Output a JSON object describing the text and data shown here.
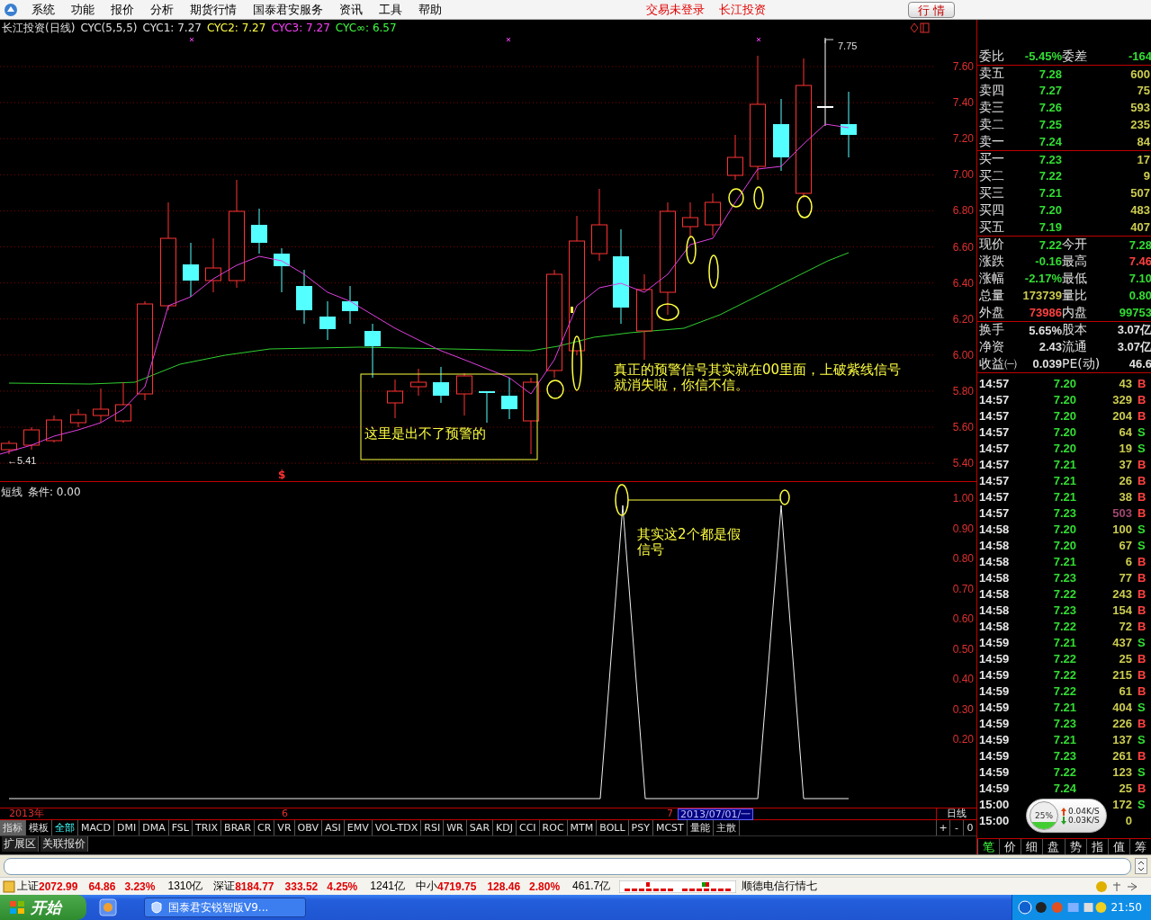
{
  "menu": {
    "items": [
      "系统",
      "功能",
      "报价",
      "分析",
      "期货行情",
      "国泰君安服务",
      "资讯",
      "工具",
      "帮助"
    ],
    "status": [
      "交易未登录",
      "长江投资"
    ],
    "button": "行 情"
  },
  "chart": {
    "legend": [
      {
        "text": "长江投资(日线)",
        "color": "#e0e0e0"
      },
      {
        "text": "CYC(5,5,5)",
        "color": "#e0e0e0"
      },
      {
        "text": "CYC1: 7.27",
        "color": "#e0e0e0"
      },
      {
        "text": "CYC2: 7.27",
        "color": "#ffff40"
      },
      {
        "text": "CYC3: 7.27",
        "color": "#ff40ff"
      },
      {
        "text": "CYC∞: 6.57",
        "color": "#40ff40"
      }
    ],
    "price_axis": [
      "7.60",
      "7.40",
      "7.20",
      "7.00",
      "6.80",
      "6.60",
      "6.40",
      "6.20",
      "6.00",
      "5.80",
      "5.60",
      "5.40"
    ],
    "low_label": "←5.41",
    "high_label": "7.75",
    "signal_mark": "$",
    "notes": [
      "这里是出不了预警的",
      "真正的预警信号其实就在00里面，上破紫线信号就消失啦，你信不信。"
    ]
  },
  "indicator": {
    "name": "短线",
    "condition": "条件: 0.00",
    "axis": [
      "1.00",
      "0.90",
      "0.80",
      "0.70",
      "0.60",
      "0.50",
      "0.40",
      "0.30",
      "0.20"
    ],
    "note": "其实这2个都是假信号"
  },
  "date_axis": {
    "labels": [
      "2013年",
      "6",
      "7"
    ],
    "cursor": "2013/07/01/一",
    "period": "日线"
  },
  "indicator_tabs": [
    {
      "label": "指标",
      "selected": true,
      "accent": false
    },
    {
      "label": "模板",
      "selected": false,
      "accent": false
    },
    {
      "label": "全部",
      "selected": false,
      "accent": true
    },
    {
      "label": "MACD",
      "selected": false,
      "accent": false
    },
    {
      "label": "DMI",
      "selected": false,
      "accent": false
    },
    {
      "label": "DMA",
      "selected": false,
      "accent": false
    },
    {
      "label": "FSL",
      "selected": false,
      "accent": false
    },
    {
      "label": "TRIX",
      "selected": false,
      "accent": false
    },
    {
      "label": "BRAR",
      "selected": false,
      "accent": false
    },
    {
      "label": "CR",
      "selected": false,
      "accent": false
    },
    {
      "label": "VR",
      "selected": false,
      "accent": false
    },
    {
      "label": "OBV",
      "selected": false,
      "accent": false
    },
    {
      "label": "ASI",
      "selected": false,
      "accent": false
    },
    {
      "label": "EMV",
      "selected": false,
      "accent": false
    },
    {
      "label": "VOL-TDX",
      "selected": false,
      "accent": false
    },
    {
      "label": "RSI",
      "selected": false,
      "accent": false
    },
    {
      "label": "WR",
      "selected": false,
      "accent": false
    },
    {
      "label": "SAR",
      "selected": false,
      "accent": false
    },
    {
      "label": "KDJ",
      "selected": false,
      "accent": false
    },
    {
      "label": "CCI",
      "selected": false,
      "accent": false
    },
    {
      "label": "ROC",
      "selected": false,
      "accent": false
    },
    {
      "label": "MTM",
      "selected": false,
      "accent": false
    },
    {
      "label": "BOLL",
      "selected": false,
      "accent": false
    },
    {
      "label": "PSY",
      "selected": false,
      "accent": false
    },
    {
      "label": "MCST",
      "selected": false,
      "accent": false
    },
    {
      "label": "量能",
      "selected": false,
      "accent": false
    },
    {
      "label": "主散",
      "selected": false,
      "accent": false
    }
  ],
  "zoom_buttons": [
    "+",
    "-",
    "0"
  ],
  "extra_tabs": [
    "扩展区",
    "关联报价"
  ],
  "quote": {
    "ratio": [
      {
        "label": "委比",
        "value": "-5.45%",
        "color": "#33dd33"
      },
      {
        "label": "委差",
        "value": "-164",
        "color": "#33dd33"
      }
    ],
    "asks": [
      {
        "label": "卖五",
        "price": "7.28",
        "volume": "600"
      },
      {
        "label": "卖四",
        "price": "7.27",
        "volume": "75"
      },
      {
        "label": "卖三",
        "price": "7.26",
        "volume": "593"
      },
      {
        "label": "卖二",
        "price": "7.25",
        "volume": "235"
      },
      {
        "label": "卖一",
        "price": "7.24",
        "volume": "84"
      }
    ],
    "bids": [
      {
        "label": "买一",
        "price": "7.23",
        "volume": "17"
      },
      {
        "label": "买二",
        "price": "7.22",
        "volume": "9"
      },
      {
        "label": "买三",
        "price": "7.21",
        "volume": "507"
      },
      {
        "label": "买四",
        "price": "7.20",
        "volume": "483"
      },
      {
        "label": "买五",
        "price": "7.19",
        "volume": "407"
      }
    ],
    "stats": [
      [
        {
          "label": "现价",
          "value": "7.22",
          "color": "#33dd33"
        },
        {
          "label": "今开",
          "value": "7.28",
          "color": "#33dd33"
        }
      ],
      [
        {
          "label": "涨跌",
          "value": "-0.16",
          "color": "#33dd33"
        },
        {
          "label": "最高",
          "value": "7.46",
          "color": "#ff4040"
        }
      ],
      [
        {
          "label": "涨幅",
          "value": "-2.17%",
          "color": "#33dd33"
        },
        {
          "label": "最低",
          "value": "7.10",
          "color": "#33dd33"
        }
      ],
      [
        {
          "label": "总量",
          "value": "173739",
          "color": "#cccc50"
        },
        {
          "label": "量比",
          "value": "0.80",
          "color": "#33dd33"
        }
      ],
      [
        {
          "label": "外盘",
          "value": "73986",
          "color": "#ff4040"
        },
        {
          "label": "内盘",
          "value": "99753",
          "color": "#33dd33"
        }
      ]
    ],
    "finance": [
      [
        {
          "label": "换手",
          "value": "5.65%"
        },
        {
          "label": "股本",
          "value": "3.07亿"
        }
      ],
      [
        {
          "label": "净资",
          "value": "2.43"
        },
        {
          "label": "流通",
          "value": "3.07亿"
        }
      ],
      [
        {
          "label": "收益㈠",
          "value": "0.039"
        },
        {
          "label": "PE(动)",
          "value": "46.6"
        }
      ]
    ]
  },
  "trades": [
    {
      "time": "14:57",
      "price": "7.20",
      "volume": "43",
      "side": "B",
      "kind": "buy",
      "large": false
    },
    {
      "time": "14:57",
      "price": "7.20",
      "volume": "329",
      "side": "B",
      "kind": "buy",
      "large": false
    },
    {
      "time": "14:57",
      "price": "7.20",
      "volume": "204",
      "side": "B",
      "kind": "buy",
      "large": false
    },
    {
      "time": "14:57",
      "price": "7.20",
      "volume": "64",
      "side": "S",
      "kind": "sell",
      "large": false
    },
    {
      "time": "14:57",
      "price": "7.20",
      "volume": "19",
      "side": "S",
      "kind": "sell",
      "large": false
    },
    {
      "time": "14:57",
      "price": "7.21",
      "volume": "37",
      "side": "B",
      "kind": "buy",
      "large": false
    },
    {
      "time": "14:57",
      "price": "7.21",
      "volume": "26",
      "side": "B",
      "kind": "buy",
      "large": false
    },
    {
      "time": "14:57",
      "price": "7.21",
      "volume": "38",
      "side": "B",
      "kind": "buy",
      "large": false
    },
    {
      "time": "14:57",
      "price": "7.23",
      "volume": "503",
      "side": "B",
      "kind": "buy",
      "large": true
    },
    {
      "time": "14:58",
      "price": "7.20",
      "volume": "100",
      "side": "S",
      "kind": "sell",
      "large": false
    },
    {
      "time": "14:58",
      "price": "7.20",
      "volume": "67",
      "side": "S",
      "kind": "sell",
      "large": false
    },
    {
      "time": "14:58",
      "price": "7.21",
      "volume": "6",
      "side": "B",
      "kind": "buy",
      "large": false
    },
    {
      "time": "14:58",
      "price": "7.23",
      "volume": "77",
      "side": "B",
      "kind": "buy",
      "large": false
    },
    {
      "time": "14:58",
      "price": "7.22",
      "volume": "243",
      "side": "B",
      "kind": "buy",
      "large": false
    },
    {
      "time": "14:58",
      "price": "7.23",
      "volume": "154",
      "side": "B",
      "kind": "buy",
      "large": false
    },
    {
      "time": "14:58",
      "price": "7.22",
      "volume": "72",
      "side": "B",
      "kind": "buy",
      "large": false
    },
    {
      "time": "14:59",
      "price": "7.21",
      "volume": "437",
      "side": "S",
      "kind": "sell",
      "large": false
    },
    {
      "time": "14:59",
      "price": "7.22",
      "volume": "25",
      "side": "B",
      "kind": "buy",
      "large": false
    },
    {
      "time": "14:59",
      "price": "7.22",
      "volume": "215",
      "side": "B",
      "kind": "buy",
      "large": false
    },
    {
      "time": "14:59",
      "price": "7.22",
      "volume": "61",
      "side": "B",
      "kind": "buy",
      "large": false
    },
    {
      "time": "14:59",
      "price": "7.21",
      "volume": "404",
      "side": "S",
      "kind": "sell",
      "large": false
    },
    {
      "time": "14:59",
      "price": "7.23",
      "volume": "226",
      "side": "B",
      "kind": "buy",
      "large": false
    },
    {
      "time": "14:59",
      "price": "7.21",
      "volume": "137",
      "side": "S",
      "kind": "sell",
      "large": false
    },
    {
      "time": "14:59",
      "price": "7.23",
      "volume": "261",
      "side": "B",
      "kind": "buy",
      "large": false
    },
    {
      "time": "14:59",
      "price": "7.22",
      "volume": "123",
      "side": "S",
      "kind": "sell",
      "large": false
    },
    {
      "time": "14:59",
      "price": "7.24",
      "volume": "25",
      "side": "B",
      "kind": "buy",
      "large": false
    },
    {
      "time": "15:00",
      "volume": "172",
      "side": "S",
      "kind": "sell",
      "large": false
    },
    {
      "time": "15:00",
      "volume": "0",
      "large": false
    }
  ],
  "panel_tabs": [
    {
      "label": "笔",
      "selected": true
    },
    {
      "label": "价",
      "selected": false
    },
    {
      "label": "细",
      "selected": false
    },
    {
      "label": "盘",
      "selected": false
    },
    {
      "label": "势",
      "selected": false
    },
    {
      "label": "指",
      "selected": false
    },
    {
      "label": "值",
      "selected": false
    },
    {
      "label": "筹",
      "selected": false
    }
  ],
  "network": {
    "usage": "25%",
    "upload": "0.04K/S",
    "download": "0.03K/S"
  },
  "status_bar": {
    "indices": [
      {
        "name": "上证",
        "price": "2072.99",
        "change": "64.86",
        "percent": "3.23%",
        "amount": "1310亿"
      },
      {
        "name": "深证",
        "price": "8184.77",
        "change": "333.52",
        "percent": "4.25%",
        "amount": "1241亿"
      },
      {
        "name": "中小",
        "price": "4719.75",
        "change": "128.46",
        "percent": "2.80%",
        "amount": "461.7亿"
      }
    ],
    "server": "顺德电信行情七"
  },
  "taskbar": {
    "start": "开始",
    "task": "国泰君安锐智版V9...",
    "clock": "21:50"
  }
}
